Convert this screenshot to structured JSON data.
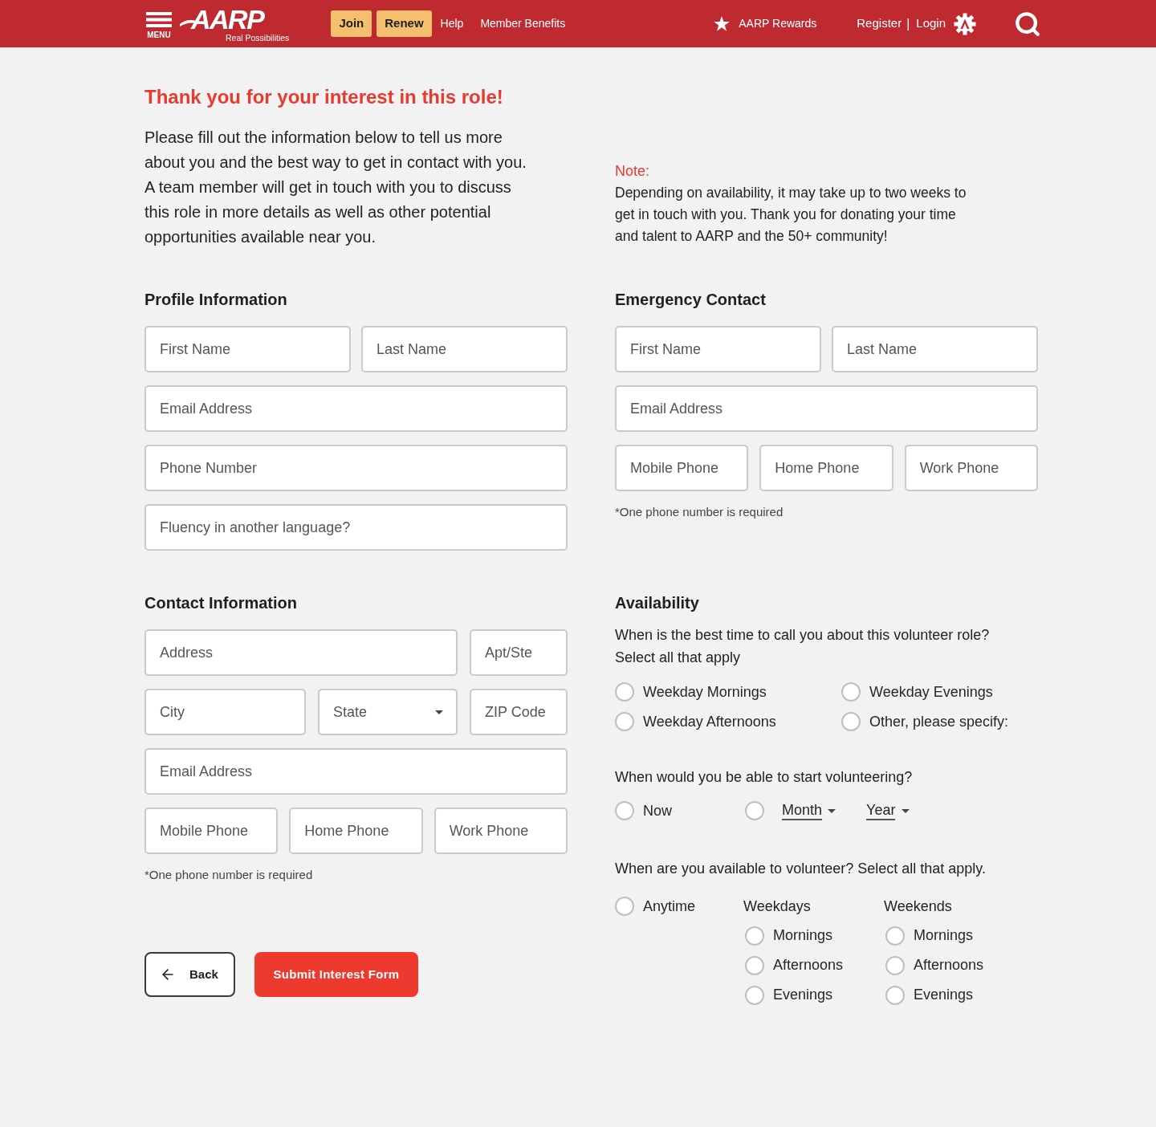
{
  "header": {
    "menu_label": "MENU",
    "logo": "AARP",
    "tagline": "Real Possibilities",
    "buttons": [
      "Join",
      "Renew"
    ],
    "links": [
      "Help",
      "Member Benefits"
    ],
    "rewards": "AARP Rewards",
    "account_links": [
      "Register",
      "Login"
    ],
    "separator": "|"
  },
  "intro": {
    "title": "Thank you for your interest in this role!",
    "body": "Please fill out the information below to tell us more about you and the best way to get in contact with you. A team member will get in touch with you to discuss this role in more details as well as other potential opportunities available near you."
  },
  "note": {
    "label": "Note:",
    "body": "Depending on availability, it may take up to two weeks to get in touch with you. Thank you for donating your time and talent to AARP and the 50+ community!"
  },
  "profile": {
    "heading": "Profile Information",
    "rows": [
      {
        "fields": [
          {
            "kind": "text",
            "placeholder": "First Name"
          },
          {
            "kind": "text",
            "placeholder": "Last Name"
          }
        ]
      },
      {
        "fields": [
          {
            "kind": "text",
            "placeholder": "Email Address"
          }
        ]
      },
      {
        "fields": [
          {
            "kind": "text",
            "placeholder": "Phone Number"
          }
        ]
      },
      {
        "fields": [
          {
            "kind": "text",
            "placeholder": "Fluency in another language?"
          }
        ]
      }
    ]
  },
  "emergency": {
    "heading": "Emergency Contact",
    "rows": [
      {
        "fields": [
          {
            "kind": "text",
            "placeholder": "First Name"
          },
          {
            "kind": "text",
            "placeholder": "Last Name"
          }
        ]
      },
      {
        "fields": [
          {
            "kind": "text",
            "placeholder": "Email Address"
          }
        ]
      },
      {
        "fields": [
          {
            "kind": "text",
            "placeholder": "Mobile Phone"
          },
          {
            "kind": "text",
            "placeholder": "Home Phone"
          },
          {
            "kind": "text",
            "placeholder": "Work Phone"
          }
        ]
      }
    ],
    "footnote": "*One phone number is required"
  },
  "contact": {
    "heading": "Contact Information",
    "rows": [
      {
        "fields": [
          {
            "kind": "text",
            "placeholder": "Address"
          },
          {
            "kind": "text",
            "placeholder": "Apt/Ste"
          }
        ]
      },
      {
        "fields": [
          {
            "kind": "text",
            "placeholder": "City"
          },
          {
            "kind": "select",
            "placeholder": "State"
          },
          {
            "kind": "text",
            "placeholder": "ZIP Code"
          }
        ]
      },
      {
        "fields": [
          {
            "kind": "text",
            "placeholder": "Email Address"
          }
        ]
      },
      {
        "fields": [
          {
            "kind": "text",
            "placeholder": "Mobile Phone"
          },
          {
            "kind": "text",
            "placeholder": "Home Phone"
          },
          {
            "kind": "text",
            "placeholder": "Work Phone"
          }
        ]
      }
    ],
    "footnote": "*One phone number is required"
  },
  "availability": {
    "heading": "Availability",
    "call_time": {
      "question": "When is the best time to call you about this volunteer role?",
      "hint": "Select all that apply",
      "options": [
        {
          "label": "Weekday Mornings",
          "selected": false
        },
        {
          "label": "Weekday Evenings",
          "selected": false
        },
        {
          "label": "Weekday Afternoons",
          "selected": false
        },
        {
          "label": "Other, please specify:",
          "selected": false
        }
      ]
    },
    "start": {
      "question": "When would you be able to start volunteering?",
      "options": [
        {
          "kind": "plain",
          "label": "Now",
          "selected": false
        },
        {
          "kind": "date",
          "selected": false,
          "month": "Month",
          "year": "Year"
        }
      ]
    },
    "schedule": {
      "question": "When are you available to volunteer? Select all that apply.",
      "anytime": {
        "label": "Anytime",
        "selected": false
      },
      "groups": [
        {
          "title": "Weekdays",
          "options": [
            {
              "label": "Mornings",
              "selected": false
            },
            {
              "label": "Afternoons",
              "selected": false
            },
            {
              "label": "Evenings",
              "selected": false
            }
          ]
        },
        {
          "title": "Weekends",
          "options": [
            {
              "label": "Mornings",
              "selected": false
            },
            {
              "label": "Afternoons",
              "selected": false
            },
            {
              "label": "Evenings",
              "selected": false
            }
          ]
        }
      ]
    }
  },
  "actions": {
    "back": "Back",
    "submit": "Submit Interest Form"
  }
}
